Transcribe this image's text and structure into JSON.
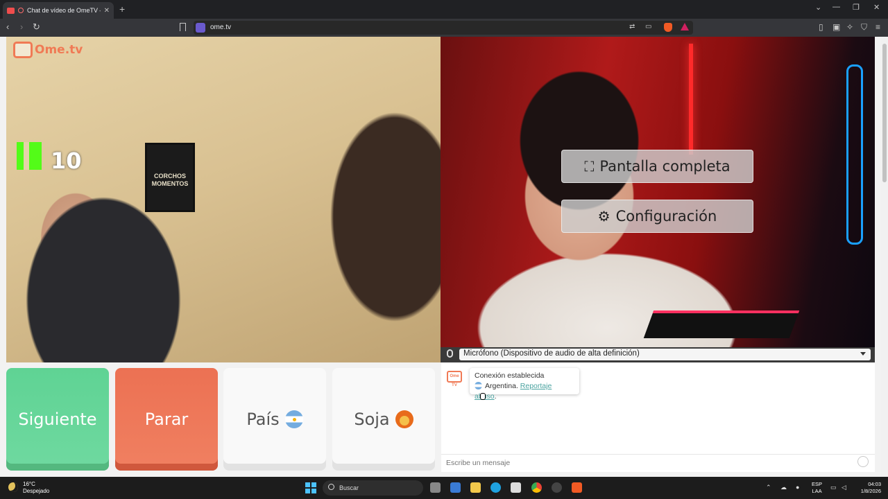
{
  "browser": {
    "tab_title": "Chat de vídeo de OmeTV — A",
    "tab_close": "✕",
    "new_tab": "+",
    "url": "ome.tv",
    "window_controls": {
      "dropdown": "⌄",
      "minimize": "—",
      "restore": "❐",
      "close": "✕"
    }
  },
  "video_left": {
    "logo_text": "Ome.tv",
    "poster_text": "CORCHOS MOMENTOS",
    "kick_count": "10"
  },
  "video_right": {
    "fullscreen_label": "Pantalla completa",
    "settings_label": "Configuración"
  },
  "microphone": {
    "selected": "Micrófono (Dispositivo de audio de alta definición)"
  },
  "controls": {
    "next_label": "Siguiente",
    "stop_label": "Parar",
    "country_label": "País",
    "gender_label": "Soja"
  },
  "chat": {
    "logo_text": "Ome TV",
    "status": "Conexión establecida",
    "country": "Argentina.",
    "report_link": "Reportaje abuso",
    "report_suffix": ".",
    "input_placeholder": "Escribe un mensaje"
  },
  "taskbar": {
    "temperature": "16°C",
    "weather": "Despejado",
    "search_placeholder": "Buscar",
    "lang_top": "ESP",
    "lang_bottom": "LAA",
    "time": "04:03",
    "date": "1/8/2026"
  },
  "colors": {
    "next": "#5fd394",
    "stop": "#ec7153",
    "brand": "#f07a55",
    "kick": "#53fc18",
    "link": "#4aa3a0"
  }
}
